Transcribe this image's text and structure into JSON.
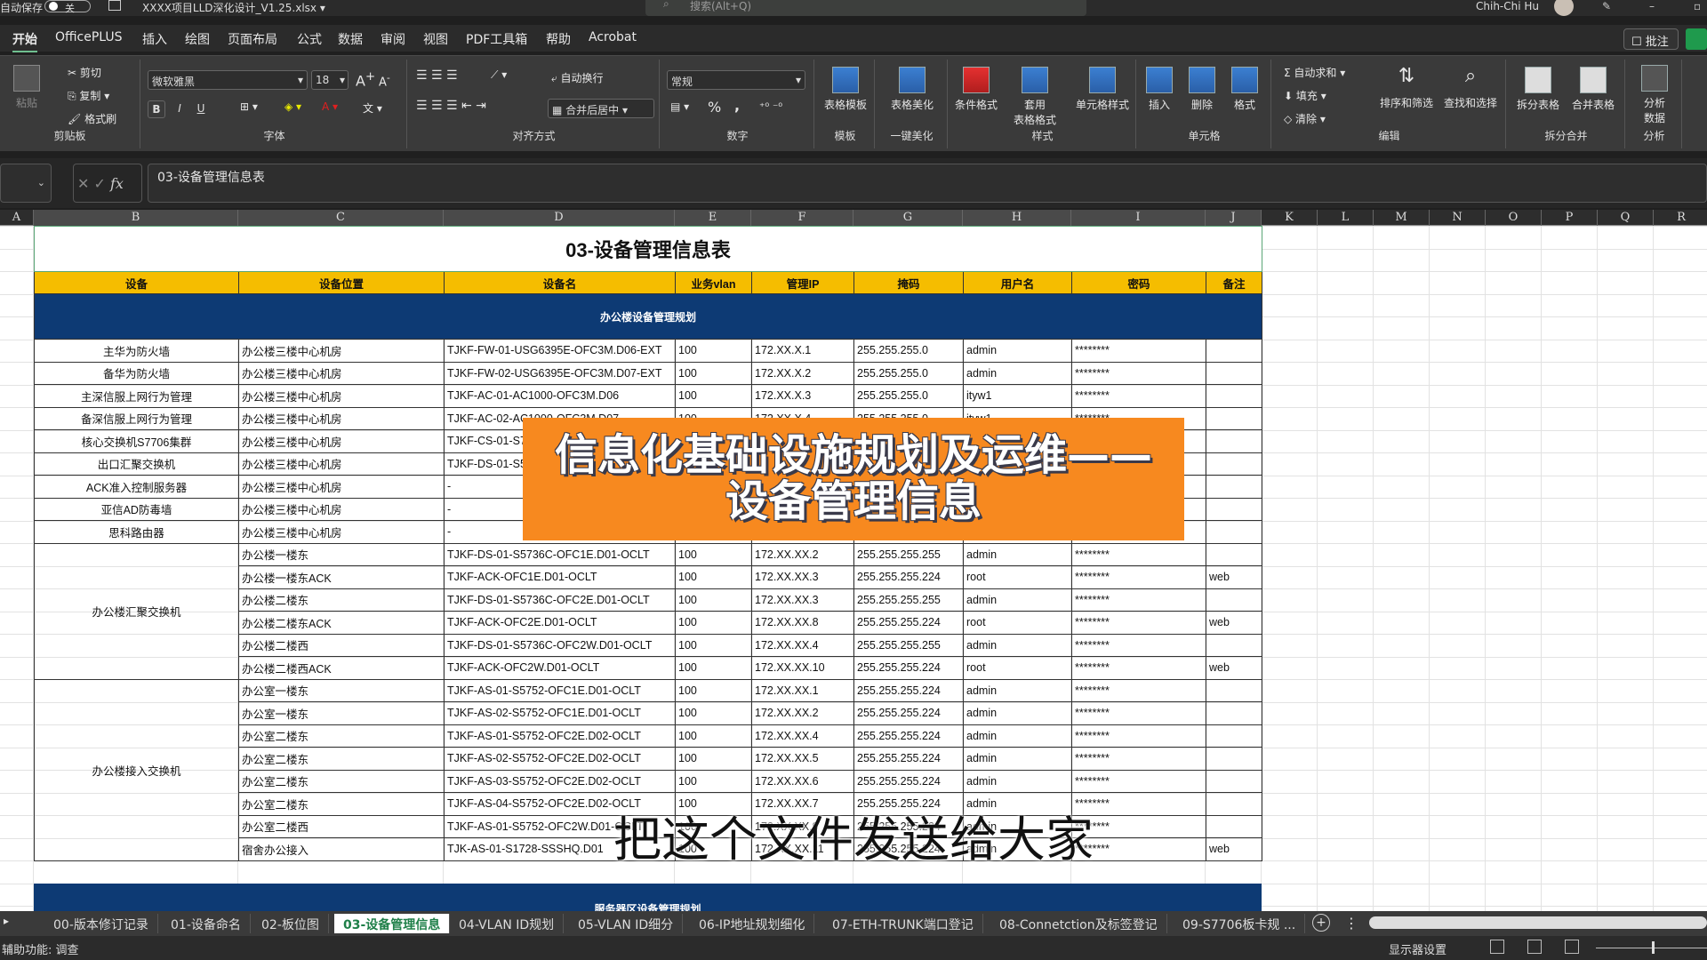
{
  "titlebar": {
    "autosave_label": "自动保存",
    "autosave_state": "关",
    "filename": "XXXX项目LLD深化设计_V1.25.xlsx ▾",
    "search_placeholder": "搜索(Alt+Q)",
    "user_name": "Chih-Chi Hu"
  },
  "menu": {
    "tabs": [
      "开始",
      "OfficePLUS",
      "插入",
      "绘图",
      "页面布局",
      "公式",
      "数据",
      "审阅",
      "视图",
      "PDF工具箱",
      "帮助",
      "Acrobat"
    ],
    "active_tab": "开始",
    "comment_label": "批注"
  },
  "ribbon": {
    "clipboard": {
      "paste": "粘贴",
      "cut": "剪切",
      "copy": "复制",
      "format_painter": "格式刷",
      "label": "剪贴板"
    },
    "font": {
      "name": "微软雅黑",
      "size": "18",
      "bold": "B",
      "italic": "I",
      "underline": "U",
      "label": "字体"
    },
    "alignment": {
      "wrap": "自动换行",
      "merge": "合并后居中",
      "label": "对齐方式"
    },
    "number": {
      "format": "常规",
      "percent": "%",
      "comma": ",",
      "label": "数字"
    },
    "template": {
      "table_template": "表格模板",
      "label": "模板"
    },
    "beautify": {
      "table_beautify": "表格美化",
      "label": "一键美化"
    },
    "styles": {
      "conditional": "条件格式",
      "apply_table": "套用\n表格格式",
      "cell_styles": "单元格样式",
      "label": "样式"
    },
    "cells": {
      "insert": "插入",
      "delete": "删除",
      "format": "格式",
      "label": "单元格"
    },
    "editing": {
      "autosum": "自动求和",
      "fill": "填充",
      "clear": "清除",
      "sort_filter": "排序和筛选",
      "find_select": "查找和选择",
      "label": "编辑"
    },
    "split_merge": {
      "split": "拆分表格",
      "merge": "合并表格",
      "label": "拆分合并"
    },
    "analysis": {
      "analyze": "分析\n数据",
      "label": "分析"
    }
  },
  "formula_bar": {
    "content": "03-设备管理信息表",
    "fx": "fx"
  },
  "columns": [
    "A",
    "B",
    "C",
    "D",
    "E",
    "F",
    "G",
    "H",
    "I",
    "J",
    "K",
    "L",
    "M",
    "N",
    "O",
    "P",
    "Q",
    "R"
  ],
  "sheet": {
    "title": "03-设备管理信息表",
    "headers": [
      "设备",
      "设备位置",
      "设备名",
      "业务vlan",
      "管理IP",
      "掩码",
      "用户名",
      "密码",
      "备注"
    ],
    "section1": "办公楼设备管理规划",
    "section2": "服务器区设备管理规划",
    "rows_single": [
      {
        "device": "主华为防火墙",
        "location": "办公楼三楼中心机房",
        "name": "TJKF-FW-01-USG6395E-OFC3M.D06-EXT",
        "vlan": "100",
        "ip": "172.XX.X.1",
        "mask": "255.255.255.0",
        "user": "admin",
        "pwd": "********",
        "note": ""
      },
      {
        "device": "备华为防火墙",
        "location": "办公楼三楼中心机房",
        "name": "TJKF-FW-02-USG6395E-OFC3M.D07-EXT",
        "vlan": "100",
        "ip": "172.XX.X.2",
        "mask": "255.255.255.0",
        "user": "admin",
        "pwd": "********",
        "note": ""
      },
      {
        "device": "主深信服上网行为管理",
        "location": "办公楼三楼中心机房",
        "name": "TJKF-AC-01-AC1000-OFC3M.D06",
        "vlan": "100",
        "ip": "172.XX.X.3",
        "mask": "255.255.255.0",
        "user": "ityw1",
        "pwd": "********",
        "note": ""
      },
      {
        "device": "备深信服上网行为管理",
        "location": "办公楼三楼中心机房",
        "name": "TJKF-AC-02-AC1000-OFC3M.D07",
        "vlan": "100",
        "ip": "172.XX.X.4",
        "mask": "255.255.255.0",
        "user": "ityw1",
        "pwd": "********",
        "note": ""
      },
      {
        "device": "核心交换机S7706集群",
        "location": "办公楼三楼中心机房",
        "name": "TJKF-CS-01-S7",
        "vlan": "",
        "ip": "",
        "mask": "",
        "user": "",
        "pwd": "",
        "note": ""
      },
      {
        "device": "出口汇聚交换机",
        "location": "办公楼三楼中心机房",
        "name": "TJKF-DS-01-S5",
        "vlan": "",
        "ip": "",
        "mask": "",
        "user": "",
        "pwd": "",
        "note": ""
      },
      {
        "device": "ACK准入控制服务器",
        "location": "办公楼三楼中心机房",
        "name": "-",
        "vlan": "",
        "ip": "",
        "mask": "",
        "user": "",
        "pwd": "",
        "note": ""
      },
      {
        "device": "亚信AD防毒墙",
        "location": "办公楼三楼中心机房",
        "name": "-",
        "vlan": "",
        "ip": "",
        "mask": "",
        "user": "",
        "pwd": "",
        "note": ""
      },
      {
        "device": "思科路由器",
        "location": "办公楼三楼中心机房",
        "name": "-",
        "vlan": "",
        "ip": "",
        "mask": "",
        "user": "",
        "pwd": "",
        "note": ""
      }
    ],
    "group_agg": {
      "device": "办公楼汇聚交换机",
      "rows": [
        {
          "location": "办公楼一楼东",
          "name": "TJKF-DS-01-S5736C-OFC1E.D01-OCLT",
          "vlan": "100",
          "ip": "172.XX.XX.2",
          "mask": "255.255.255.255",
          "user": "admin",
          "pwd": "********",
          "note": ""
        },
        {
          "location": "办公楼一楼东ACK",
          "name": "TJKF-ACK-OFC1E.D01-OCLT",
          "vlan": "100",
          "ip": "172.XX.XX.3",
          "mask": "255.255.255.224",
          "user": "root",
          "pwd": "********",
          "note": "web"
        },
        {
          "location": "办公楼二楼东",
          "name": "TJKF-DS-01-S5736C-OFC2E.D01-OCLT",
          "vlan": "100",
          "ip": "172.XX.XX.3",
          "mask": "255.255.255.255",
          "user": "admin",
          "pwd": "********",
          "note": ""
        },
        {
          "location": "办公楼二楼东ACK",
          "name": "TJKF-ACK-OFC2E.D01-OCLT",
          "vlan": "100",
          "ip": "172.XX.XX.8",
          "mask": "255.255.255.224",
          "user": "root",
          "pwd": "********",
          "note": "web"
        },
        {
          "location": "办公楼二楼西",
          "name": "TJKF-DS-01-S5736C-OFC2W.D01-OCLT",
          "vlan": "100",
          "ip": "172.XX.XX.4",
          "mask": "255.255.255.255",
          "user": "admin",
          "pwd": "********",
          "note": ""
        },
        {
          "location": "办公楼二楼西ACK",
          "name": "TJKF-ACK-OFC2W.D01-OCLT",
          "vlan": "100",
          "ip": "172.XX.XX.10",
          "mask": "255.255.255.224",
          "user": "root",
          "pwd": "********",
          "note": "web"
        }
      ]
    },
    "group_access": {
      "device": "办公楼接入交换机",
      "rows": [
        {
          "location": "办公室一楼东",
          "name": "TJKF-AS-01-S5752-OFC1E.D01-OCLT",
          "vlan": "100",
          "ip": "172.XX.XX.1",
          "mask": "255.255.255.224",
          "user": "admin",
          "pwd": "********",
          "note": ""
        },
        {
          "location": "办公室一楼东",
          "name": "TJKF-AS-02-S5752-OFC1E.D01-OCLT",
          "vlan": "100",
          "ip": "172.XX.XX.2",
          "mask": "255.255.255.224",
          "user": "admin",
          "pwd": "********",
          "note": ""
        },
        {
          "location": "办公室二楼东",
          "name": "TJKF-AS-01-S5752-OFC2E.D02-OCLT",
          "vlan": "100",
          "ip": "172.XX.XX.4",
          "mask": "255.255.255.224",
          "user": "admin",
          "pwd": "********",
          "note": ""
        },
        {
          "location": "办公室二楼东",
          "name": "TJKF-AS-02-S5752-OFC2E.D02-OCLT",
          "vlan": "100",
          "ip": "172.XX.XX.5",
          "mask": "255.255.255.224",
          "user": "admin",
          "pwd": "********",
          "note": ""
        },
        {
          "location": "办公室二楼东",
          "name": "TJKF-AS-03-S5752-OFC2E.D02-OCLT",
          "vlan": "100",
          "ip": "172.XX.XX.6",
          "mask": "255.255.255.224",
          "user": "admin",
          "pwd": "********",
          "note": ""
        },
        {
          "location": "办公室二楼东",
          "name": "TJKF-AS-04-S5752-OFC2E.D02-OCLT",
          "vlan": "100",
          "ip": "172.XX.XX.7",
          "mask": "255.255.255.224",
          "user": "admin",
          "pwd": "********",
          "note": ""
        },
        {
          "location": "办公室二楼西",
          "name": "TJKF-AS-01-S5752-OFC2W.D01-OCLT",
          "vlan": "100",
          "ip": "172.XX.XX.9",
          "mask": "255.255.255.224",
          "user": "admin",
          "pwd": "********",
          "note": ""
        },
        {
          "location": "宿舍办公接入",
          "name": "TJK-AS-01-S1728-SSSHQ.D01",
          "vlan": "100",
          "ip": "172.XX.XX.11",
          "mask": "255.255.255.224",
          "user": "admin",
          "pwd": "********",
          "note": "web"
        }
      ]
    }
  },
  "overlay": {
    "banner_line1": "信息化基础设施规划及运维——",
    "banner_line2": "设备管理信息",
    "subtitle": "把这个文件发送给大家"
  },
  "sheet_tabs": {
    "tabs": [
      "00-版本修订记录",
      "01-设备命名",
      "02-板位图",
      "03-设备管理信息",
      "04-VLAN ID规划",
      "05-VLAN ID细分",
      "06-IP地址规划细化",
      "07-ETH-TRUNK端口登记",
      "08-Connetction及标签登记",
      "09-S7706板卡规 ..."
    ],
    "active": "03-设备管理信息"
  },
  "status": {
    "accessibility": "辅助功能: 调查",
    "display_settings": "显示器设置"
  }
}
